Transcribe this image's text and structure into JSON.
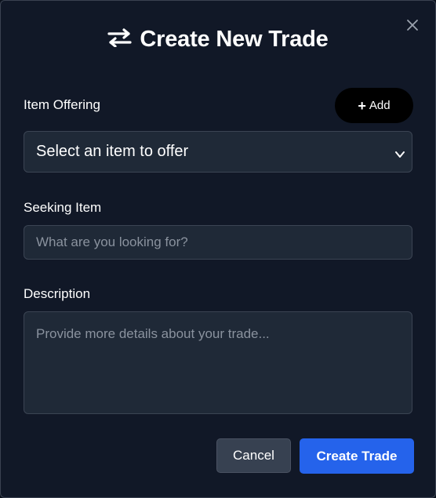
{
  "dialog": {
    "title": "Create New Trade",
    "title_icon": "swap-arrows-icon",
    "close_icon": "close-icon"
  },
  "offering": {
    "label": "Item Offering",
    "add_label": "Add",
    "add_icon": "plus-icon",
    "select_value": "Select an item to offer",
    "select_icon": "chevron-down-icon"
  },
  "seeking": {
    "label": "Seeking Item",
    "placeholder": "What are you looking for?"
  },
  "description": {
    "label": "Description",
    "placeholder": "Provide more details about your trade..."
  },
  "actions": {
    "cancel_label": "Cancel",
    "create_label": "Create Trade"
  },
  "colors": {
    "background": "#111827",
    "field_background": "#1f2937",
    "primary": "#2563eb",
    "secondary": "#374151"
  }
}
